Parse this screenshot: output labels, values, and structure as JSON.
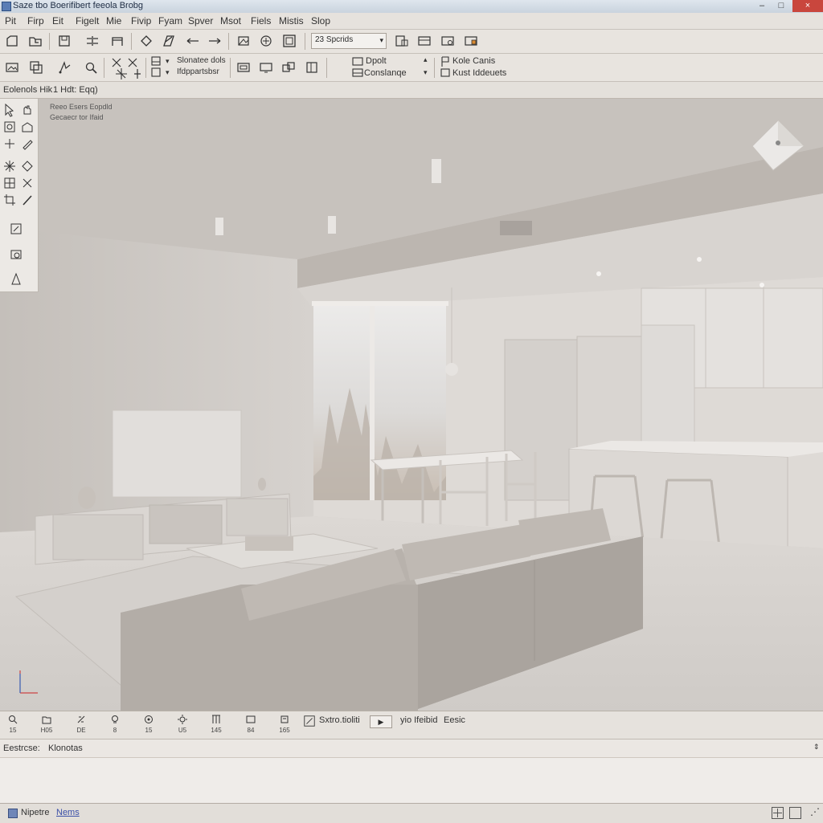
{
  "window": {
    "title": "Saze tbo Boerifibert feeola Brobg",
    "min": "–",
    "max": "□",
    "close": "×"
  },
  "menu": [
    "Pit",
    "Firp",
    "Eit",
    "Figelt",
    "Mie",
    "Fivip",
    "Fyam",
    "Spver",
    "Msot",
    "Fiels",
    "Mistis",
    "Slop"
  ],
  "toolbar1": {
    "combo_value": "23 Spcrids"
  },
  "toolbar2": {
    "label_a1": "Slonatee dols",
    "label_a2": "Ifdppartsbsr",
    "label_b1": "Dpolt",
    "label_b2": "Conslanqe",
    "label_c1": "Kole Canis",
    "label_c2": "Kust Iddeuets"
  },
  "optbar": {
    "left": "Eolenols Hik",
    "right": "1 Hdt: Eqq)"
  },
  "viewport": {
    "info1": "Reeo Esers Eopdld",
    "info2": "Gecaecr tor Ifaid"
  },
  "bottombar": {
    "items": [
      "15",
      "H05",
      "DE",
      "8",
      "15",
      "U5",
      "145",
      "84",
      "165"
    ],
    "label1": "Sxtro.tioliti",
    "label2": "yio Ifeibid",
    "label3": "Eesic"
  },
  "status": {
    "label": "Eestrcse:",
    "value": "Klonotas"
  },
  "footer": {
    "label": "Nipetre",
    "link": "Nems"
  },
  "colors": {
    "title_bar": "#c9d3de",
    "accent_link": "#3a4fa8",
    "close": "#c9463d",
    "viewport_bg": "#cfcac6"
  }
}
